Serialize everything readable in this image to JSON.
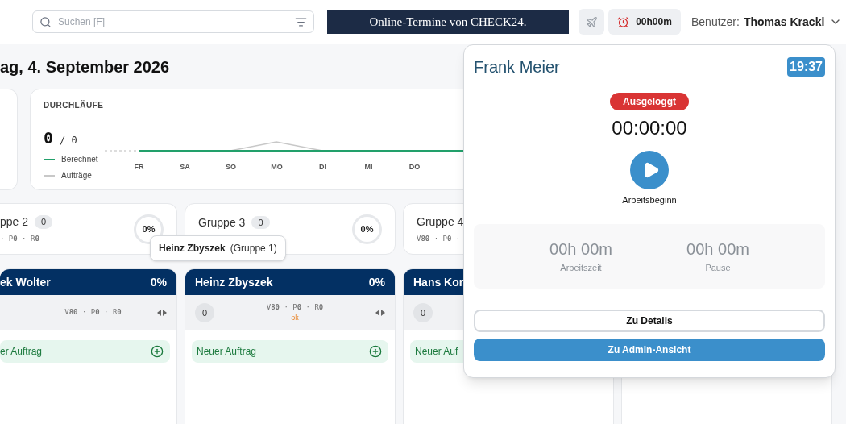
{
  "header": {
    "search": {
      "placeholder": "Suchen [F]"
    },
    "banner": "Online-Termine von CHECK24.",
    "timer": "00h00m",
    "user_label": "Benutzer:",
    "user_name": "Thomas Krackl"
  },
  "date_title": "ag, 4. September 2026",
  "runs_card": {
    "title": "DURCHLÄUFE",
    "count": "0",
    "total": "/ 0",
    "legend": [
      {
        "label": "Berechnet",
        "color": "#22a06b"
      },
      {
        "label": "Aufträge",
        "color": "#c8c8c8"
      }
    ],
    "day_labels": [
      "FR",
      "SA",
      "SO",
      "MO",
      "DI",
      "MI",
      "DO"
    ]
  },
  "groups": [
    {
      "name": "ppe 2",
      "count": "0",
      "stats": "· P**0** · R**0**",
      "percent": "0%"
    },
    {
      "name": "Gruppe 3",
      "count": "0",
      "percent": "0%"
    },
    {
      "name": "Gruppe 4",
      "stats": "V**80** · P**0** ·"
    }
  ],
  "tooltip": {
    "name": "Heinz Zbyszek",
    "group": "(Gruppe 1)"
  },
  "columns": [
    {
      "name": "ek Wolter",
      "percent": "0%",
      "stats": "V**80** · P**0** · R**0**",
      "arrows": true,
      "new_label": "er Auftrag",
      "add_icon": true
    },
    {
      "name": "Heinz Zbyszek",
      "percent": "0%",
      "counter": "0",
      "stats": "V**80** · P**0** · R**0**",
      "arrows": true,
      "status": "ok",
      "new_label": "Neuer Auftrag",
      "add_icon": true
    },
    {
      "name": "Hans Kor",
      "counter": "0",
      "new_label": "Neuer Auf"
    }
  ],
  "popup": {
    "name": "Frank Meier",
    "time": "19:37",
    "status": {
      "kind": "logged_out",
      "label": "Ausgeloggt"
    },
    "clock": "00:00:00",
    "start_label": "Arbeitsbeginn",
    "totals": [
      {
        "value": "00h 00m",
        "label": "Arbeitszeit"
      },
      {
        "value": "00h 00m",
        "label": "Pause"
      }
    ],
    "buttons": [
      {
        "kind": "outline",
        "label": "Zu Details"
      },
      {
        "kind": "primary",
        "label": "Zu Admin-Ansicht"
      }
    ]
  }
}
